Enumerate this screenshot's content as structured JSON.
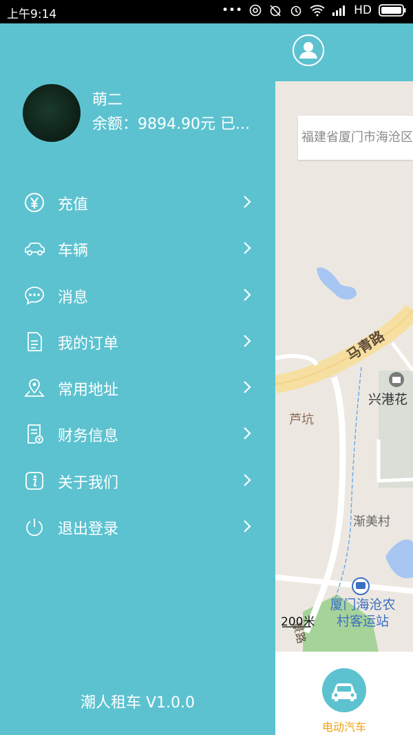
{
  "status_bar": {
    "time": "上午9:14",
    "network": "HD"
  },
  "drawer": {
    "user_name": "萌二",
    "balance": "余额：9894.90元   已...",
    "menu": [
      {
        "label": "充值",
        "icon": "yen-icon"
      },
      {
        "label": "车辆",
        "icon": "car-icon"
      },
      {
        "label": "消息",
        "icon": "message-icon"
      },
      {
        "label": "我的订单",
        "icon": "order-icon"
      },
      {
        "label": "常用地址",
        "icon": "location-icon"
      },
      {
        "label": "财务信息",
        "icon": "finance-icon"
      },
      {
        "label": "关于我们",
        "icon": "info-icon"
      },
      {
        "label": "退出登录",
        "icon": "power-icon"
      }
    ],
    "version": "潮人租车   V1.0.0"
  },
  "map": {
    "address": "福建省厦门市海沧区",
    "labels": {
      "road": "马青路",
      "place1": "兴港花",
      "place2": "芦坑",
      "place3": "渐美村",
      "road2": "景路",
      "station": "厦门海沧农村客运站"
    },
    "scale": "200米"
  },
  "bottom_bar": {
    "label": "电动汽车"
  },
  "colors": {
    "accent": "#5cc2d0",
    "highlight": "#f0a012"
  }
}
